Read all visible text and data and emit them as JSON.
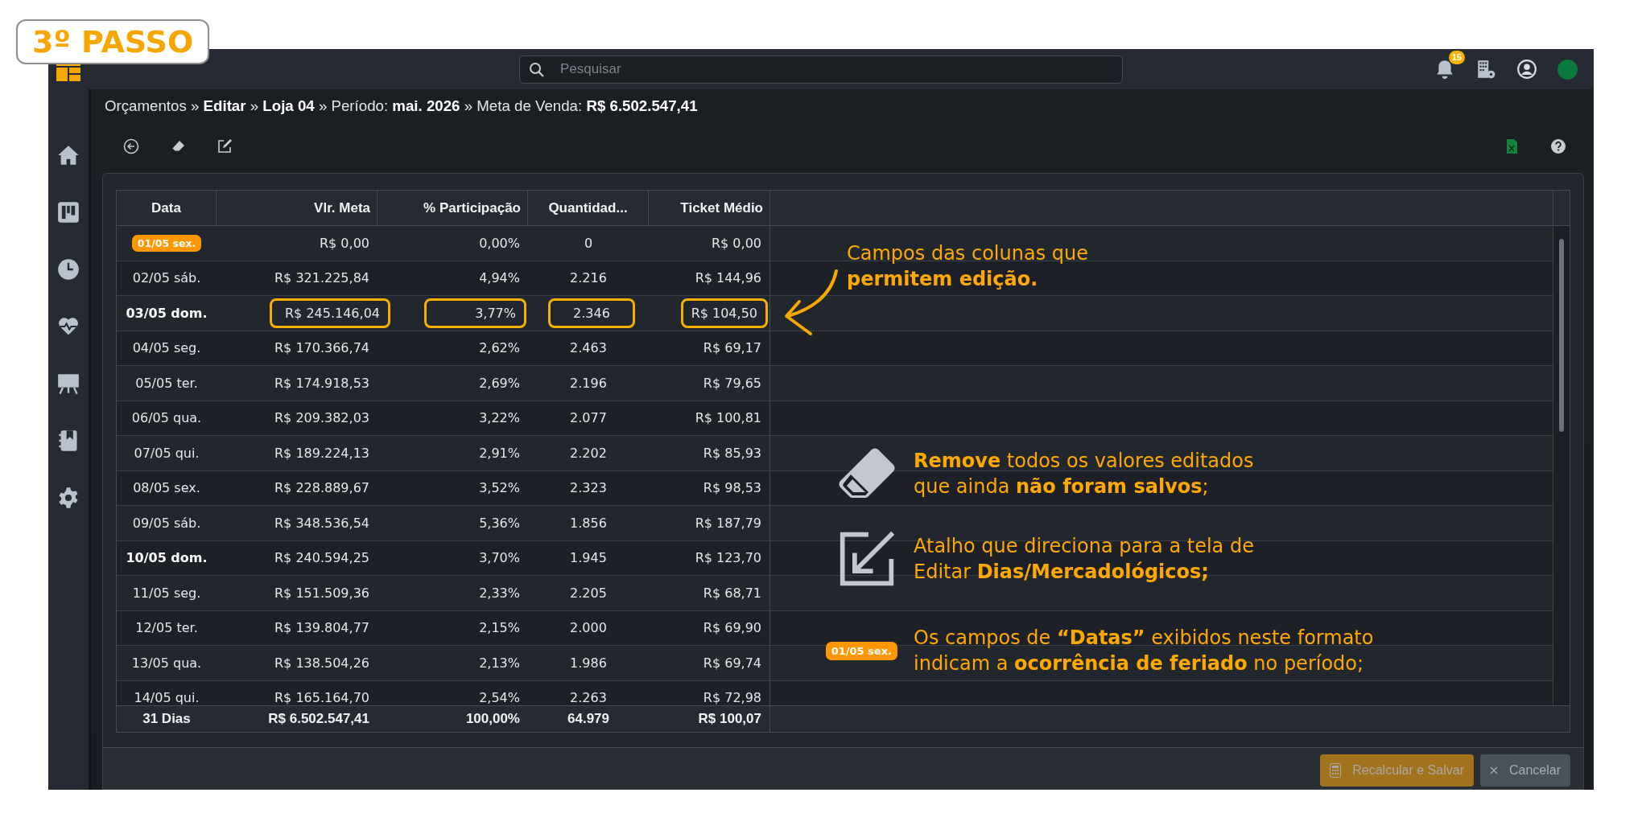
{
  "step_badge": "3º PASSO",
  "topbar": {
    "search": {
      "placeholder": "Pesquisar"
    },
    "notification_count": "15"
  },
  "breadcrumb": "Orçamentos » **Editar** » **Loja 04** » Período: **mai. 2026** » Meta de Venda: **R$ 6.502.547,41**",
  "table": {
    "columns": [
      "Data",
      "Vlr. Meta",
      "% Participação",
      "Quantidad...",
      "Ticket Médio"
    ],
    "rows": [
      {
        "cells": [
          "01/05 sex.",
          "R$ 0,00",
          "0,00%",
          "0",
          "R$ 0,00"
        ],
        "holiday": true,
        "bold": false,
        "highlighted": false
      },
      {
        "cells": [
          "02/05 sáb.",
          "R$ 321.225,84",
          "4,94%",
          "2.216",
          "R$ 144,96"
        ],
        "holiday": false,
        "bold": false,
        "highlighted": false
      },
      {
        "cells": [
          "03/05 dom.",
          "R$ 245.146,04",
          "3,77%",
          "2.346",
          "R$ 104,50"
        ],
        "holiday": false,
        "bold": true,
        "highlighted": true
      },
      {
        "cells": [
          "04/05 seg.",
          "R$ 170.366,74",
          "2,62%",
          "2.463",
          "R$ 69,17"
        ],
        "holiday": false,
        "bold": false,
        "highlighted": false
      },
      {
        "cells": [
          "05/05 ter.",
          "R$ 174.918,53",
          "2,69%",
          "2.196",
          "R$ 79,65"
        ],
        "holiday": false,
        "bold": false,
        "highlighted": false
      },
      {
        "cells": [
          "06/05 qua.",
          "R$ 209.382,03",
          "3,22%",
          "2.077",
          "R$ 100,81"
        ],
        "holiday": false,
        "bold": false,
        "highlighted": false
      },
      {
        "cells": [
          "07/05 qui.",
          "R$ 189.224,13",
          "2,91%",
          "2.202",
          "R$ 85,93"
        ],
        "holiday": false,
        "bold": false,
        "highlighted": false
      },
      {
        "cells": [
          "08/05 sex.",
          "R$ 228.889,67",
          "3,52%",
          "2.323",
          "R$ 98,53"
        ],
        "holiday": false,
        "bold": false,
        "highlighted": false
      },
      {
        "cells": [
          "09/05 sáb.",
          "R$ 348.536,54",
          "5,36%",
          "1.856",
          "R$ 187,79"
        ],
        "holiday": false,
        "bold": false,
        "highlighted": false
      },
      {
        "cells": [
          "10/05 dom.",
          "R$ 240.594,25",
          "3,70%",
          "1.945",
          "R$ 123,70"
        ],
        "holiday": false,
        "bold": true,
        "highlighted": false
      },
      {
        "cells": [
          "11/05 seg.",
          "R$ 151.509,36",
          "2,33%",
          "2.205",
          "R$ 68,71"
        ],
        "holiday": false,
        "bold": false,
        "highlighted": false
      },
      {
        "cells": [
          "12/05 ter.",
          "R$ 139.804,77",
          "2,15%",
          "2.000",
          "R$ 69,90"
        ],
        "holiday": false,
        "bold": false,
        "highlighted": false
      },
      {
        "cells": [
          "13/05 qua.",
          "R$ 138.504,26",
          "2,13%",
          "1.986",
          "R$ 69,74"
        ],
        "holiday": false,
        "bold": false,
        "highlighted": false
      },
      {
        "cells": [
          "14/05 qui.",
          "R$ 165.164,70",
          "2,54%",
          "2.263",
          "R$ 72,98"
        ],
        "holiday": false,
        "bold": false,
        "highlighted": false
      }
    ],
    "totals": [
      "31 Dias",
      "R$ 6.502.547,41",
      "100,00%",
      "64.979",
      "R$ 100,07"
    ]
  },
  "annotations": {
    "callout": "Campos das colunas que\n**permitem edição.**",
    "items": [
      {
        "kind": "eraser",
        "text": "**Remove** todos os valores editados\nque ainda **não foram salvos**;"
      },
      {
        "kind": "edit",
        "text": "Atalho que direciona para a tela de\nEditar **Dias/Mercadológicos;**"
      },
      {
        "kind": "holiday",
        "badge": "01/05 sex.",
        "text": "Os campos de **“Datas”** exibidos neste formato\nindicam a **ocorrência de feriado** no período;"
      }
    ]
  },
  "buttons": [
    {
      "label": "Recalcular e Salvar",
      "kind": "primary",
      "disabled": true
    },
    {
      "label": "Cancelar",
      "kind": "cancel",
      "disabled": true
    }
  ]
}
